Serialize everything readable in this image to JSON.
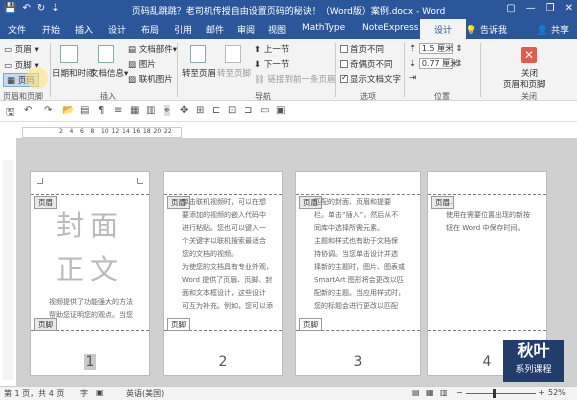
{
  "window": {
    "title": "页码乱跳跳？老司机传授自由设置页码的秘诀！（Word版）案例.docx - Word",
    "qat": [
      "💾",
      "↶",
      "↻",
      "⇣"
    ],
    "controls": [
      "▢",
      "—",
      "❐",
      "✕"
    ]
  },
  "tabs": [
    "文件",
    "开始",
    "插入",
    "设计",
    "布局",
    "引用",
    "邮件",
    "审阅",
    "视图",
    "MathType",
    "NoteExpress",
    "设计"
  ],
  "tell_me": "告诉我",
  "share": "共享",
  "ribbon": {
    "header_label": "页眉",
    "footer_label": "页脚",
    "pagenum_label": "页码",
    "group_header_footer": "页眉和页脚",
    "datetime_label": "日期和时间",
    "docinfo_label": "文档信息",
    "docparts_label": "文档部件",
    "picture_label": "图片",
    "online_picture_label": "联机图片",
    "group_insert": "插入",
    "goto_header_label": "转至页眉",
    "goto_footer_label": "转至页脚",
    "prev_label": "上一节",
    "next_label": "下一节",
    "link_prev_label": "链接到前一条页眉",
    "group_nav": "导航",
    "opt_first_page": "首页不同",
    "opt_odd_even": "奇偶页不同",
    "opt_show_text": "显示文档文字",
    "group_options": "选项",
    "header_pos": "1.5 厘米",
    "footer_pos": "0.77 厘米",
    "group_position": "位置",
    "close_label_1": "关闭",
    "close_label_2": "页眉和页脚",
    "group_close": "关闭"
  },
  "ruler": {
    "numbers": [
      "2",
      "4",
      "6",
      "8",
      "10",
      "12",
      "14",
      "16",
      "18",
      "20",
      "22"
    ]
  },
  "pages": [
    {
      "header_tag": "页眉",
      "footer_tag": "页脚",
      "cover_1": "封面",
      "cover_2": "正文",
      "lines": [
        "视频提供了功能强大的方法",
        "帮助您证明您的观点。当您"
      ],
      "number": "1"
    },
    {
      "header_tag": "页眉",
      "footer_tag": "页脚",
      "lines": [
        "单击联机视频时，可以在想",
        "要添加的视频的嵌入代码中",
        "进行粘贴。您也可以键入一",
        "个关键字以联机搜索最适合",
        "您的文档的视频。",
        "为使您的文档具有专业外观，",
        "Word 提供了页眉、页脚、封",
        "面和文本框设计，这些设计",
        "可互为补充。例如，您可以添"
      ],
      "number": "2"
    },
    {
      "header_tag": "页眉",
      "footer_tag": "页脚",
      "lines": [
        "匹配的封面、页眉和提要",
        "栏。单击“插入”，然后从不",
        "同库中选择所需元素。",
        "主题和样式也有助于文档保",
        "持协调。当您单击设计并选",
        "择新的主题时，图片、图表或",
        "SmartArt 图形将会更改以匹",
        "配新的主题。当应用样式时，",
        "您的标题会进行更改以匹配"
      ],
      "number": "3"
    },
    {
      "header_tag": "页眉",
      "lines": [
        "...",
        "使用在需要位置出现的新按",
        "钮在 Word 中保存时间。"
      ],
      "number": "4"
    }
  ],
  "status": {
    "page": "第 1 页，共 4 页",
    "words": "字",
    "lang": "英语(美国)",
    "zoom": "52%"
  },
  "logo": {
    "line1": "秋叶",
    "line2": "系列课程"
  }
}
